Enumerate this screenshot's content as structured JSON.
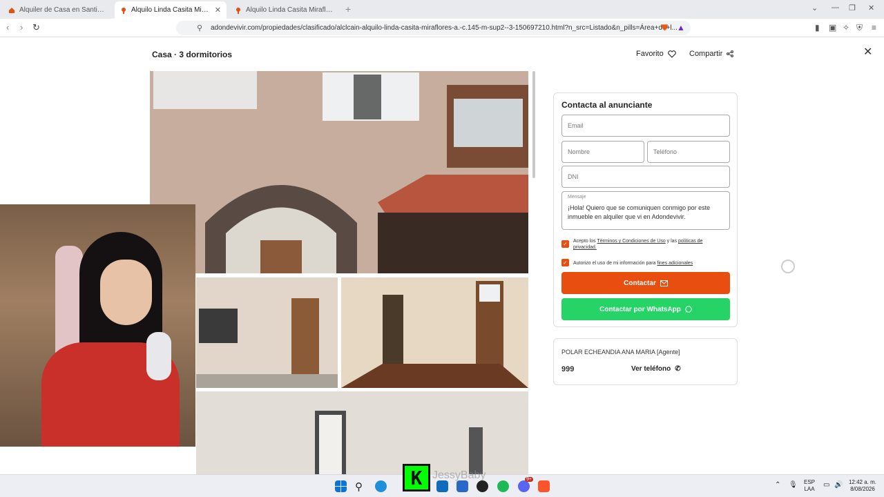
{
  "browser": {
    "tabs": [
      {
        "title": "Alquiler de Casa en Santiago de Surc",
        "active": false
      },
      {
        "title": "Alquilo Linda Casita Miraflores (A.",
        "active": true
      },
      {
        "title": "Alquilo Linda Casita Miraflores (A. C",
        "active": false
      }
    ],
    "url": "adondevivir.com/propiedades/clasificado/alclcain-alquilo-linda-casita-miraflores-a.-c.145-m-sup2--3-150697210.html?n_src=Listado&n_pills=Área+de+l...",
    "brave_badge": "2"
  },
  "listing": {
    "heading": "Casa · 3 dormitorios",
    "favorite_label": "Favorito",
    "share_label": "Compartir"
  },
  "contact_form": {
    "title": "Contacta al anunciante",
    "email_placeholder": "Email",
    "name_placeholder": "Nombre",
    "phone_placeholder": "Teléfono",
    "dni_placeholder": "DNI",
    "message_label": "Mensaje",
    "message_value": "¡Hola! Quiero que se comuniquen conmigo por este inmueble en alquiler que vi en Adondevivir.",
    "terms_prefix": "Acepto los ",
    "terms_link": "Términos y Condiciones de Uso",
    "terms_mid": " y las ",
    "privacy_link": "políticas de privacidad.",
    "consent_prefix": "Autorizo el uso de mi información para ",
    "consent_link": "fines adicionales",
    "contact_button": "Contactar",
    "whatsapp_button": "Contactar por WhatsApp"
  },
  "agent": {
    "name": "POLAR ECHEANDIA ANA MARIA [Agente]",
    "phone_partial": "999",
    "show_phone": "Ver teléfono"
  },
  "overlay": {
    "watermark": "JessyBaby",
    "logo_letter": "K"
  },
  "taskbar": {
    "lang_line1": "ESP",
    "lang_line2": "LAA",
    "time": "12:42 a. m.",
    "date": "8/08/2026",
    "notification_count": "9+"
  },
  "colors": {
    "accent": "#e84e0f",
    "whatsapp": "#25d366"
  }
}
